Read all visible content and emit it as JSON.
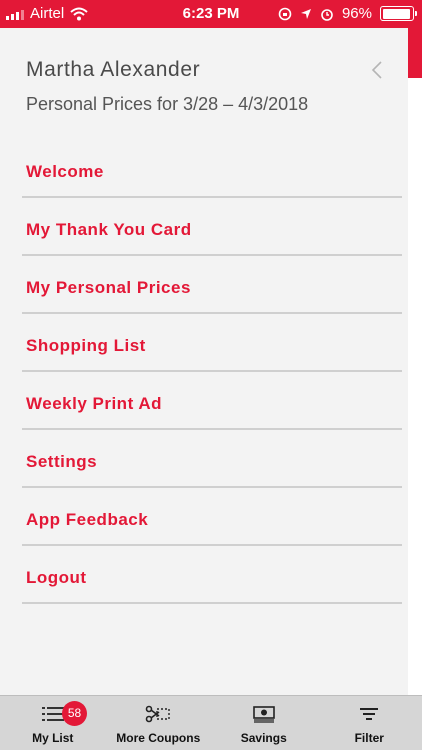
{
  "status_bar": {
    "carrier": "Airtel",
    "time": "6:23 PM",
    "battery": "96%",
    "battery_level": 0.96
  },
  "drawer": {
    "user_name": "Martha Alexander",
    "price_period": "Personal Prices for 3/28 – 4/3/2018",
    "back_icon": "chevron-left-icon",
    "menu_items": [
      {
        "label": "Welcome"
      },
      {
        "label": "My Thank You Card"
      },
      {
        "label": "My Personal Prices"
      },
      {
        "label": "Shopping List"
      },
      {
        "label": "Weekly Print Ad"
      },
      {
        "label": "Settings"
      },
      {
        "label": "App Feedback"
      },
      {
        "label": "Logout"
      }
    ]
  },
  "tab_bar": {
    "tabs": [
      {
        "label": "My List",
        "icon": "list-icon",
        "badge": "58"
      },
      {
        "label": "More Coupons",
        "icon": "scissors-coupon-icon"
      },
      {
        "label": "Savings",
        "icon": "money-icon"
      },
      {
        "label": "Filter",
        "icon": "filter-icon"
      }
    ]
  },
  "colors": {
    "brand": "#e31837",
    "drawer_bg": "#f3f3f3",
    "tab_bar_bg": "#d6d6d6"
  }
}
